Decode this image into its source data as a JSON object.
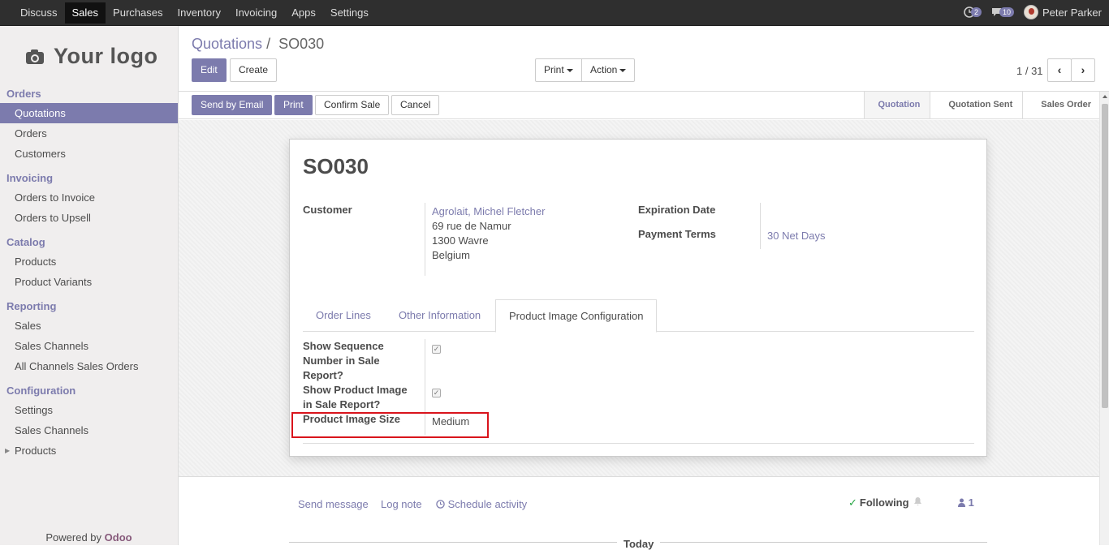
{
  "topbar": {
    "menu": [
      "Discuss",
      "Sales",
      "Purchases",
      "Inventory",
      "Invoicing",
      "Apps",
      "Settings"
    ],
    "active_menu": "Sales",
    "activity_count": "2",
    "message_count": "10",
    "user_name": "Peter Parker"
  },
  "sidebar": {
    "logo_text": "Your logo",
    "sections": [
      {
        "title": "Orders",
        "items": [
          "Quotations",
          "Orders",
          "Customers"
        ]
      },
      {
        "title": "Invoicing",
        "items": [
          "Orders to Invoice",
          "Orders to Upsell"
        ]
      },
      {
        "title": "Catalog",
        "items": [
          "Products",
          "Product Variants"
        ]
      },
      {
        "title": "Reporting",
        "items": [
          "Sales",
          "Sales Channels",
          "All Channels Sales Orders"
        ]
      },
      {
        "title": "Configuration",
        "items": [
          "Settings",
          "Sales Channels",
          "Products"
        ]
      }
    ],
    "active_item": "Quotations",
    "powered_by": "Powered by",
    "powered_brand": "Odoo"
  },
  "control": {
    "breadcrumb_parent": "Quotations",
    "breadcrumb_sep": "/",
    "breadcrumb_current": "SO030",
    "edit_label": "Edit",
    "create_label": "Create",
    "print_label": "Print",
    "action_label": "Action",
    "pager": "1 / 31"
  },
  "statusbar": {
    "send_email_label": "Send by Email",
    "print_label": "Print",
    "confirm_label": "Confirm Sale",
    "cancel_label": "Cancel",
    "stages": [
      "Quotation",
      "Quotation Sent",
      "Sales Order"
    ],
    "active_stage": "Quotation"
  },
  "sheet": {
    "title": "SO030",
    "customer_label": "Customer",
    "customer_name": "Agrolait, Michel Fletcher",
    "customer_address": [
      "69 rue de Namur",
      "1300 Wavre",
      "Belgium"
    ],
    "expiration_label": "Expiration Date",
    "payment_terms_label": "Payment Terms",
    "payment_terms_value": "30 Net Days",
    "tabs": [
      "Order Lines",
      "Other Information",
      "Product Image Configuration"
    ],
    "active_tab": "Product Image Configuration",
    "show_sequence_label": [
      "Show Sequence",
      "Number in Sale",
      "Report?"
    ],
    "show_sequence_checked": true,
    "show_image_label": [
      "Show Product Image",
      "in Sale Report?"
    ],
    "show_image_checked": true,
    "image_size_label": "Product Image Size",
    "image_size_value": "Medium"
  },
  "chatter": {
    "send_message": "Send message",
    "log_note": "Log note",
    "schedule_activity": "Schedule activity",
    "following": "Following",
    "followers_count": "1",
    "today": "Today"
  },
  "colors": {
    "accent": "#7c7bad",
    "topbar": "#2f2f2f",
    "highlight": "#d9141c"
  }
}
